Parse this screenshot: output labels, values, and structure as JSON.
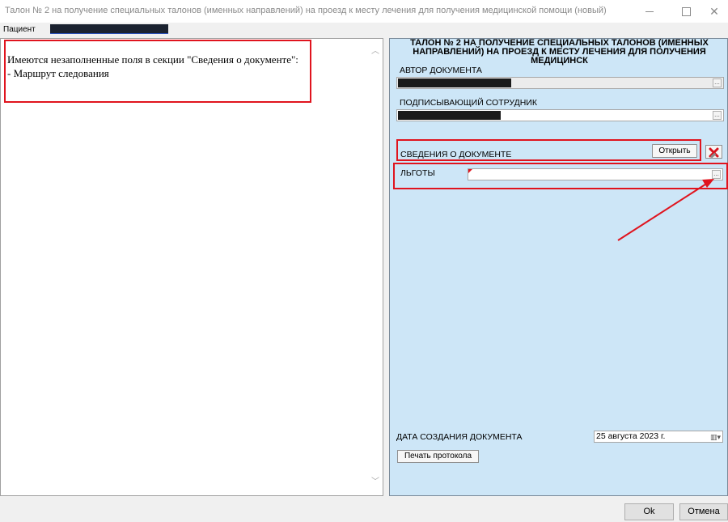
{
  "window": {
    "title": "Талон № 2 на получение специальных талонов (именных направлений) на проезд к месту лечения для получения медицинской помощи (новый)"
  },
  "patient": {
    "label": "Пациент"
  },
  "message": {
    "line1": "Имеются незаполненные поля в секции \"Сведения о документе\":",
    "line2": "- Маршрут следования"
  },
  "form": {
    "title_line1": "ТАЛОН № 2 НА ПОЛУЧЕНИЕ СПЕЦИАЛЬНЫХ ТАЛОНОВ (ИМЕННЫХ",
    "title_line2": "НАПРАВЛЕНИЙ) НА ПРОЕЗД К МЕСТУ ЛЕЧЕНИЯ ДЛЯ ПОЛУЧЕНИЯ МЕДИЦИНСК",
    "author_label": "АВТОР ДОКУМЕНТА",
    "signer_label": "ПОДПИСЫВАЮЩИЙ СОТРУДНИК",
    "section_label": "СВЕДЕНИЯ О ДОКУМЕНТЕ",
    "open_button": "Открыть",
    "benefits_label": "ЛЬГОТЫ",
    "date_label": "ДАТА СОЗДАНИЯ ДОКУМЕНТА",
    "date_value": "25  августа  2023 г.",
    "print_button": "Печать протокола"
  },
  "footer": {
    "ok": "Ok",
    "cancel": "Отмена"
  },
  "colors": {
    "annotation_red": "#e0141e",
    "form_background": "#cde6f7"
  }
}
